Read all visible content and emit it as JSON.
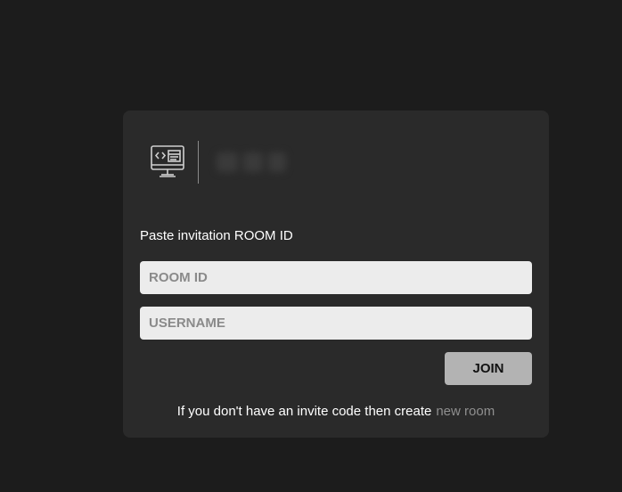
{
  "form": {
    "label": "Paste invitation ROOM ID",
    "room_id_placeholder": "ROOM ID",
    "room_id_value": "",
    "username_placeholder": "USERNAME",
    "username_value": "",
    "join_label": "JOIN"
  },
  "footer": {
    "text": "If you don't have an invite code then create",
    "link_label": "new room"
  },
  "logo": {
    "icon": "code-monitor-icon"
  },
  "colors": {
    "background": "#1c1c1c",
    "card": "#2a2a2a",
    "input_bg": "#ececec",
    "button_bg": "#b3b3b3",
    "link": "#8f8f8f"
  }
}
